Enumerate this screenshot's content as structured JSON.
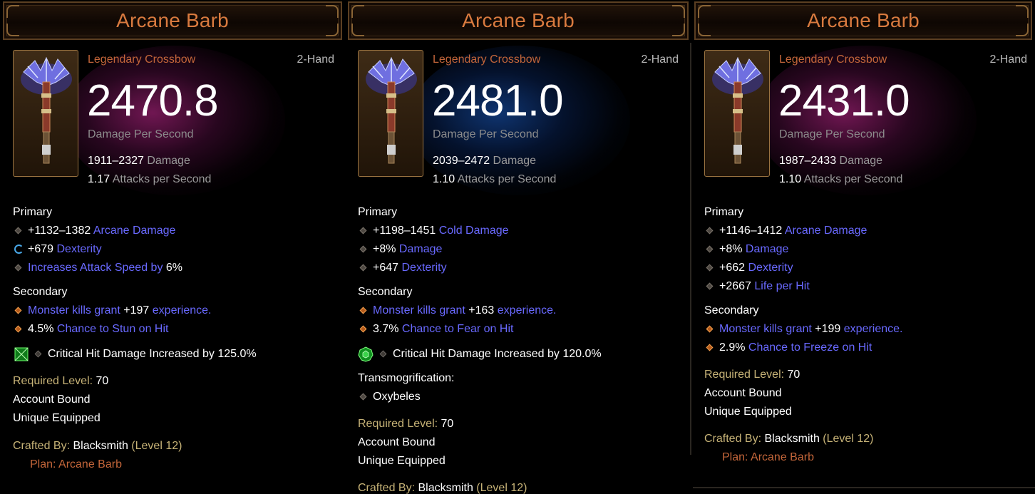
{
  "tooltips": [
    {
      "title": "Arcane Barb",
      "item_type": "Legendary Crossbow",
      "slot": "2-Hand",
      "dps": "2470.8",
      "dps_label": "Damage Per Second",
      "damage_range": "1911–2327",
      "damage_word": "Damage",
      "aps_value": "1.17",
      "aps_label": "Attacks per Second",
      "primary_header": "Primary",
      "primary": [
        {
          "value": "+1132–1382",
          "stat": "Arcane Damage",
          "icon": "diamond-bullet"
        },
        {
          "value": "+679",
          "stat": "Dexterity",
          "icon": "enchanted-cycle"
        },
        {
          "stat": "Increases Attack Speed by",
          "value": "6%",
          "icon": "diamond-bullet"
        }
      ],
      "secondary_header": "Secondary",
      "secondary": [
        {
          "stat": "Monster kills grant",
          "value": "+197",
          "suffix": "experience.",
          "icon": "orange-diamond"
        },
        {
          "value": "4.5%",
          "stat": "Chance to Stun on Hit",
          "icon": "orange-diamond"
        }
      ],
      "socket_gem": "emerald-square",
      "socket_text": "Critical Hit Damage Increased by 125.0%",
      "required_label": "Required Level:",
      "required_value": "70",
      "account_bound": "Account Bound",
      "unique_equipped": "Unique Equipped",
      "crafted_label": "Crafted By:",
      "crafted_by": "Blacksmith",
      "crafted_level": "(Level 12)",
      "plan": "Plan: Arcane Barb",
      "glow": "purple"
    },
    {
      "title": "Arcane Barb",
      "item_type": "Legendary Crossbow",
      "slot": "2-Hand",
      "dps": "2481.0",
      "dps_label": "Damage Per Second",
      "damage_range": "2039–2472",
      "damage_word": "Damage",
      "aps_value": "1.10",
      "aps_label": "Attacks per Second",
      "primary_header": "Primary",
      "primary": [
        {
          "value": "+1198–1451",
          "stat": "Cold Damage",
          "icon": "diamond-bullet"
        },
        {
          "value": "+8%",
          "stat": "Damage",
          "icon": "diamond-bullet"
        },
        {
          "value": "+647",
          "stat": "Dexterity",
          "icon": "diamond-bullet"
        }
      ],
      "secondary_header": "Secondary",
      "secondary": [
        {
          "stat": "Monster kills grant",
          "value": "+163",
          "suffix": "experience.",
          "icon": "orange-diamond"
        },
        {
          "value": "3.7%",
          "stat": "Chance to Fear on Hit",
          "icon": "orange-diamond"
        }
      ],
      "socket_gem": "emerald-round",
      "socket_text": "Critical Hit Damage Increased by 120.0%",
      "transmog_label": "Transmogrification:",
      "transmog_value": "Oxybeles",
      "required_label": "Required Level:",
      "required_value": "70",
      "account_bound": "Account Bound",
      "unique_equipped": "Unique Equipped",
      "crafted_label": "Crafted By:",
      "crafted_by": "Blacksmith",
      "crafted_level": "(Level 12)",
      "glow": "blue"
    },
    {
      "title": "Arcane Barb",
      "item_type": "Legendary Crossbow",
      "slot": "2-Hand",
      "dps": "2431.0",
      "dps_label": "Damage Per Second",
      "damage_range": "1987–2433",
      "damage_word": "Damage",
      "aps_value": "1.10",
      "aps_label": "Attacks per Second",
      "primary_header": "Primary",
      "primary": [
        {
          "value": "+1146–1412",
          "stat": "Arcane Damage",
          "icon": "diamond-bullet"
        },
        {
          "value": "+8%",
          "stat": "Damage",
          "icon": "diamond-bullet"
        },
        {
          "value": "+662",
          "stat": "Dexterity",
          "icon": "diamond-bullet"
        },
        {
          "value": "+2667",
          "stat": "Life per Hit",
          "icon": "diamond-bullet"
        }
      ],
      "secondary_header": "Secondary",
      "secondary": [
        {
          "stat": "Monster kills grant",
          "value": "+199",
          "suffix": "experience.",
          "icon": "orange-diamond"
        },
        {
          "value": "2.9%",
          "stat": "Chance to Freeze on Hit",
          "icon": "orange-diamond"
        }
      ],
      "required_label": "Required Level:",
      "required_value": "70",
      "account_bound": "Account Bound",
      "unique_equipped": "Unique Equipped",
      "crafted_label": "Crafted By:",
      "crafted_by": "Blacksmith",
      "crafted_level": "(Level 12)",
      "plan": "Plan: Arcane Barb",
      "glow": "purple"
    }
  ]
}
